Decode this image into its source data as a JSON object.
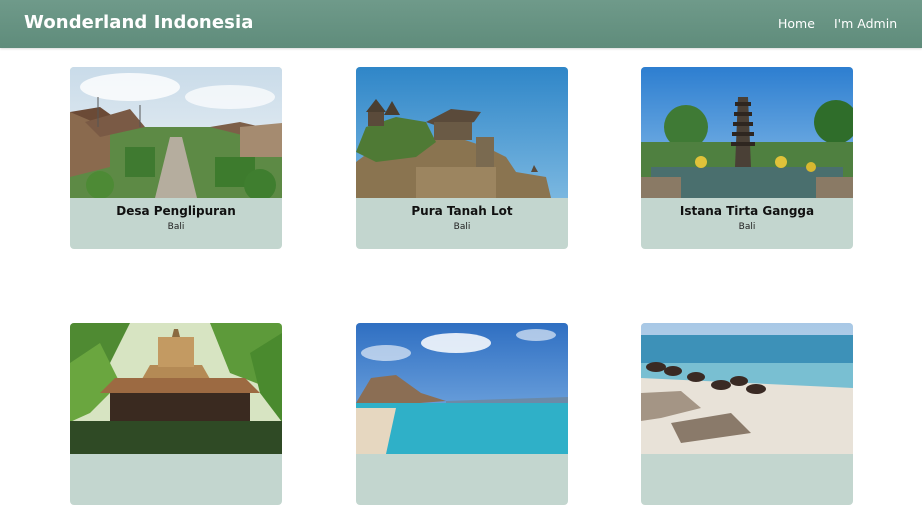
{
  "navbar": {
    "brand": "Wonderland Indonesia",
    "links": [
      {
        "label": "Home"
      },
      {
        "label": "I'm Admin"
      }
    ]
  },
  "destinations": [
    {
      "name": "Desa Penglipuran",
      "location": "Bali"
    },
    {
      "name": "Pura Tanah Lot",
      "location": "Bali"
    },
    {
      "name": "Istana Tirta Gangga",
      "location": "Bali"
    },
    {
      "name": "",
      "location": ""
    },
    {
      "name": "",
      "location": ""
    },
    {
      "name": "",
      "location": ""
    }
  ],
  "colors": {
    "navbar": "#5f8c7b",
    "card_caption_bg": "#c3d6cf"
  }
}
